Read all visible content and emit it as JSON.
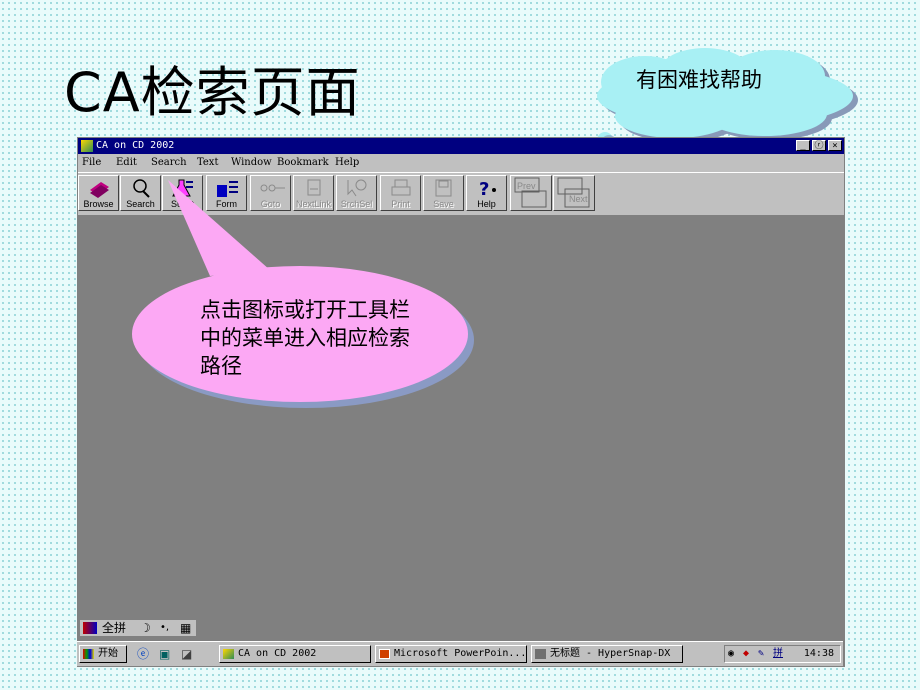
{
  "slide": {
    "title": "CA检索页面",
    "cloud_text": "有困难找帮助",
    "callout_text": "点击图标或打开工具栏中的菜单进入相应检索路径",
    "colors": {
      "cloud": "#a8f0f4",
      "callout": "#fca8f4",
      "background": "#e9fbfb"
    }
  },
  "window": {
    "title": "CA on CD 2002",
    "buttons": {
      "minimize": "_",
      "restore": "ⓡ",
      "close": "×"
    },
    "menu": [
      "File",
      "Edit",
      "Search",
      "Text",
      "Window",
      "Bookmark",
      "Help"
    ],
    "toolbar": [
      {
        "label": "Browse",
        "icon": "books-icon",
        "enabled": true
      },
      {
        "label": "Search",
        "icon": "magnifier-icon",
        "enabled": true
      },
      {
        "label": "Subst",
        "icon": "flask-icon",
        "enabled": true
      },
      {
        "label": "Form",
        "icon": "form-icon",
        "enabled": true
      },
      {
        "label": "Goto",
        "icon": "goto-icon",
        "enabled": false
      },
      {
        "label": "NextLink",
        "icon": "nextlink-icon",
        "enabled": false
      },
      {
        "label": "SrchSel",
        "icon": "srchsel-icon",
        "enabled": false
      },
      {
        "label": "Print",
        "icon": "printer-icon",
        "enabled": false
      },
      {
        "label": "Save",
        "icon": "floppy-icon",
        "enabled": false
      },
      {
        "label": "Help",
        "icon": "help-icon",
        "enabled": true
      },
      {
        "label": "Prev",
        "icon": "prev-icon",
        "enabled": false
      },
      {
        "label": "Next",
        "icon": "next-icon",
        "enabled": false
      }
    ]
  },
  "ime": {
    "mode": "全拼",
    "moon": "☽",
    "punct": "•,",
    "keyboard": "▦"
  },
  "taskbar": {
    "start": "开始",
    "tasks": [
      "CA on CD 2002",
      "Microsoft PowerPoin...",
      "无标题 - HyperSnap-DX"
    ],
    "tray_ime": "拼",
    "clock": "14:38"
  }
}
